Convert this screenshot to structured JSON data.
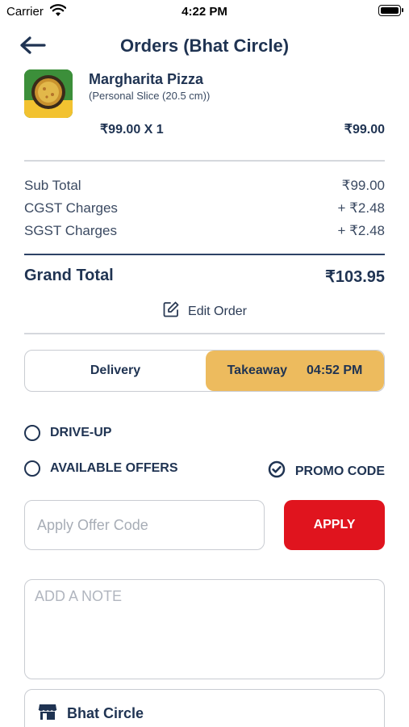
{
  "status_bar": {
    "carrier": "Carrier",
    "time": "4:22 PM"
  },
  "header": {
    "title": "Orders (Bhat Circle)",
    "back_icon": "arrow-left-icon"
  },
  "item": {
    "name": "Margharita Pizza",
    "description": "(Personal Slice (20.5 cm))",
    "quantity_price": "₹99.00 X 1",
    "amount": "₹99.00"
  },
  "summary": {
    "rows": [
      {
        "label": "Sub Total",
        "value": "₹99.00"
      },
      {
        "label": "CGST Charges",
        "value": "+ ₹2.48"
      },
      {
        "label": "SGST Charges",
        "value": "+ ₹2.48"
      }
    ],
    "grand_total_label": "Grand Total",
    "grand_total_value": "₹103.95"
  },
  "edit_order_label": "Edit Order",
  "order_type": {
    "delivery_label": "Delivery",
    "takeaway_label": "Takeaway",
    "takeaway_time": "04:52 PM",
    "selected": "Takeaway"
  },
  "options": {
    "drive_up": "DRIVE-UP",
    "available_offers": "AVAILABLE OFFERS",
    "promo_code": "PROMO CODE"
  },
  "offer_code": {
    "placeholder": "Apply Offer Code",
    "apply_label": "APPLY"
  },
  "note": {
    "placeholder": "ADD A NOTE"
  },
  "store": {
    "name": "Bhat Circle",
    "icon": "store-icon"
  },
  "colors": {
    "primary": "#1f3352",
    "accent": "#edbb5e",
    "apply": "#e0141e"
  }
}
